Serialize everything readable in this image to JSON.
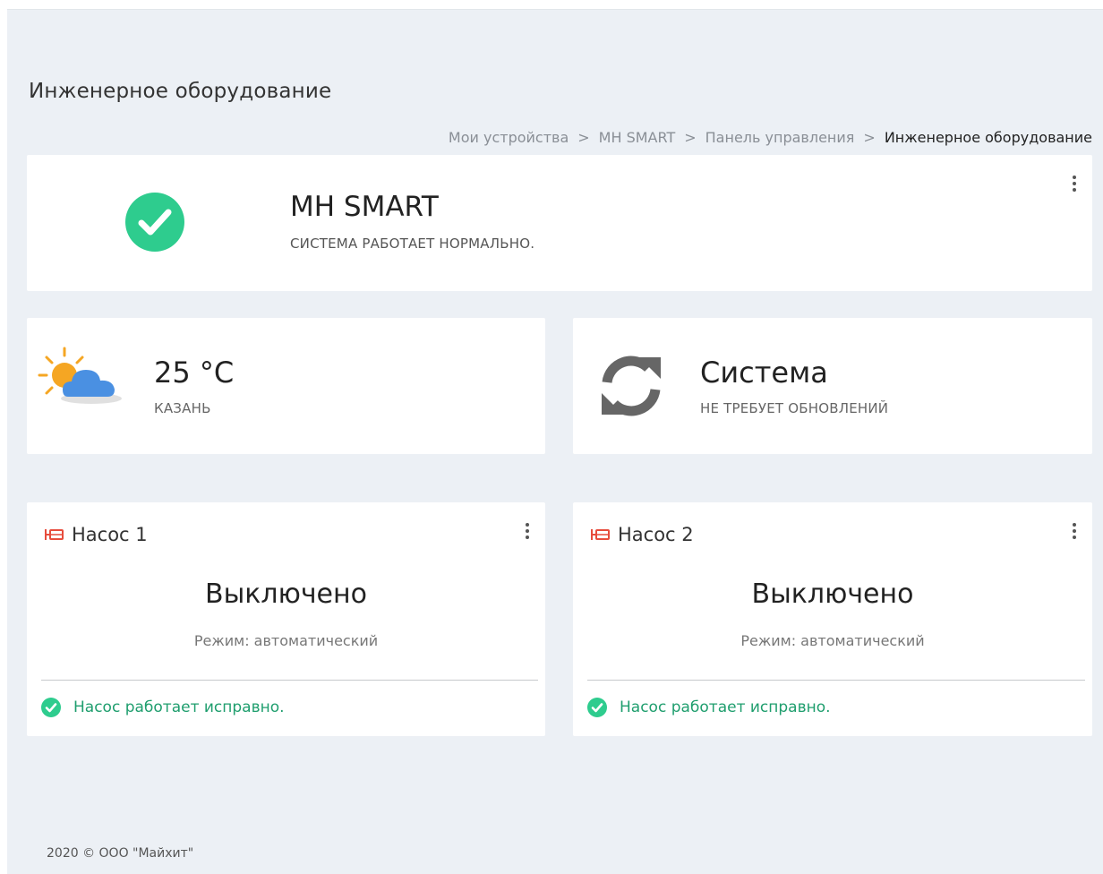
{
  "page": {
    "title": "Инженерное оборудование"
  },
  "breadcrumb": {
    "items": [
      "Мои устройства",
      "MH SMART",
      "Панель управления"
    ],
    "current": "Инженерное оборудование",
    "separator": ">"
  },
  "system_card": {
    "name": "MH SMART",
    "status": "СИСТЕМА РАБОТАЕТ НОРМАЛЬНО.",
    "icon": "check-circle-icon",
    "accent": "#2ecc8e"
  },
  "weather_card": {
    "temperature": "25 °C",
    "city": "КАЗАНЬ",
    "icon": "sun-cloud-icon"
  },
  "update_card": {
    "title": "Система",
    "status": "НЕ ТРЕБУЕТ ОБНОВЛЕНИЙ",
    "icon": "refresh-icon"
  },
  "pumps": [
    {
      "name": "Насос 1",
      "state": "Выключено",
      "mode": "Режим: автоматический",
      "status": "Насос работает исправно."
    },
    {
      "name": "Насос 2",
      "state": "Выключено",
      "mode": "Режим: автоматический",
      "status": "Насос работает исправно."
    }
  ],
  "footer": {
    "copyright": "2020 © ООО \"Майхит\""
  },
  "colors": {
    "background": "#ecf0f5",
    "success": "#2ecc8e",
    "success_text": "#1f9e6e",
    "pump_icon": "#e74c3c",
    "cloud": "#4a90e2",
    "sun": "#f5a623",
    "refresh": "#666666"
  }
}
